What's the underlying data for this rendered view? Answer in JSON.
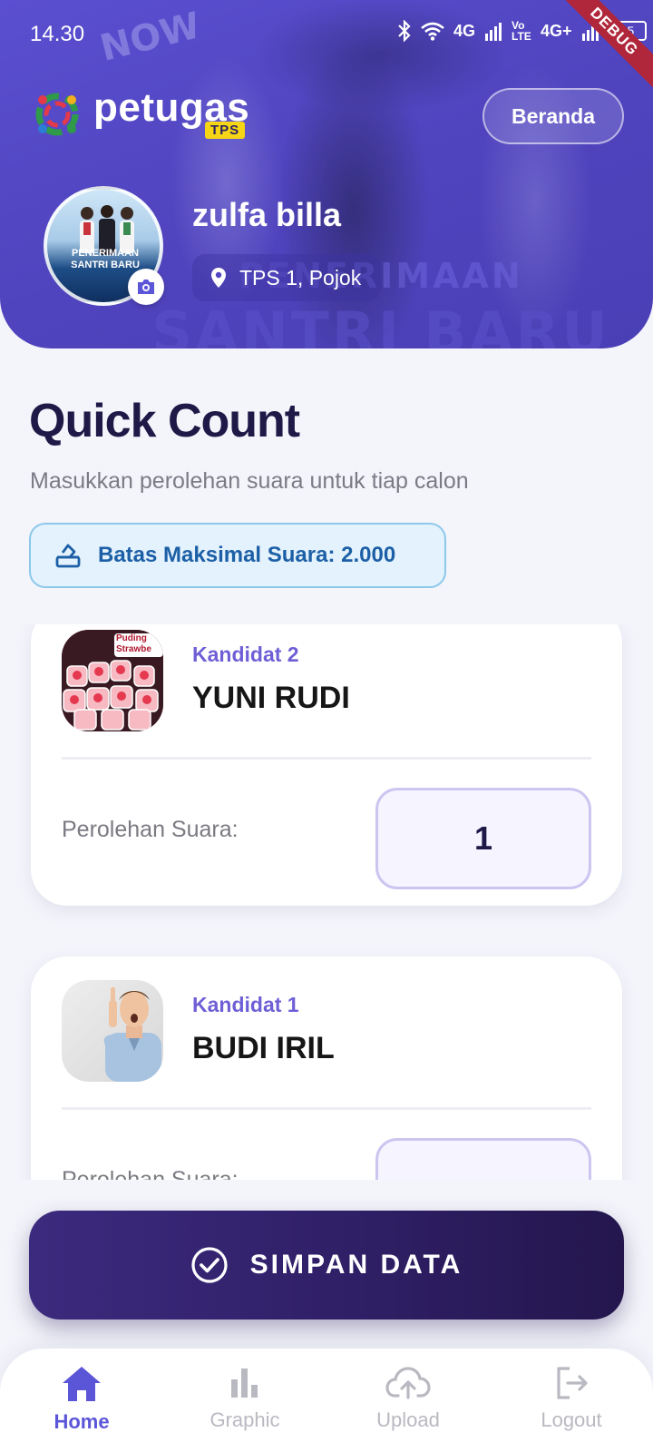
{
  "status_bar": {
    "time": "14.30",
    "network": "4G",
    "volte": "Vo LTE",
    "network2": "4G+",
    "battery": "15",
    "debug_label": "DEBUG"
  },
  "header": {
    "logo_text": "petugas",
    "logo_badge": "TPS",
    "home_button": "Beranda",
    "user_name": "zulfa billa",
    "location": "TPS 1, Pojok",
    "avatar_caption": "PENERIMAAN SANTRI BARU"
  },
  "main": {
    "title": "Quick Count",
    "subtitle": "Masukkan perolehan suara untuk tiap calon",
    "limit_label": "Batas Maksimal Suara: 2.000"
  },
  "candidates": [
    {
      "number_label": "Kandidat 2",
      "name": "YUNI RUDI",
      "photo_caption": "Puding Strawbe",
      "vote_label": "Perolehan Suara:",
      "vote_value": "1"
    },
    {
      "number_label": "Kandidat 1",
      "name": "BUDI IRIL",
      "vote_label": "Perolehan Suara:",
      "vote_value": ""
    }
  ],
  "save_button": "SIMPAN DATA",
  "nav": {
    "home": "Home",
    "graphic": "Graphic",
    "upload": "Upload",
    "logout": "Logout"
  },
  "colors": {
    "primary": "#5b55d8",
    "header": "#5145c0",
    "title": "#1e1947",
    "accent_info": "#1c5fa6",
    "save_button": "#2f1f66"
  }
}
